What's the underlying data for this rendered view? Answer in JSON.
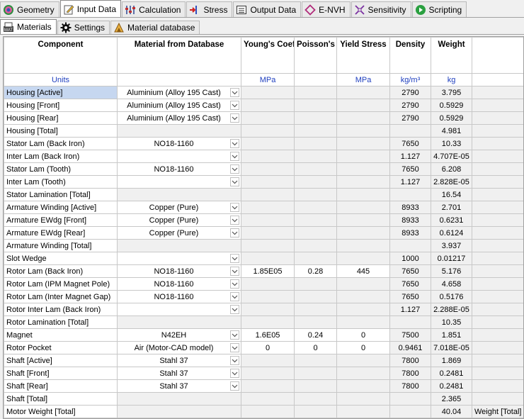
{
  "tabs": [
    {
      "label": "Geometry",
      "icon": "geometry-icon",
      "active": false
    },
    {
      "label": "Input Data",
      "icon": "input-data-icon",
      "active": true
    },
    {
      "label": "Calculation",
      "icon": "calculation-icon",
      "active": false
    },
    {
      "label": "Stress",
      "icon": "stress-icon",
      "active": false
    },
    {
      "label": "Output Data",
      "icon": "output-data-icon",
      "active": false
    },
    {
      "label": "E-NVH",
      "icon": "envh-icon",
      "active": false
    },
    {
      "label": "Sensitivity",
      "icon": "sensitivity-icon",
      "active": false
    },
    {
      "label": "Scripting",
      "icon": "scripting-icon",
      "active": false
    }
  ],
  "subtabs": [
    {
      "label": "Materials",
      "icon": "materials-icon",
      "active": true
    },
    {
      "label": "Settings",
      "icon": "settings-gear-icon",
      "active": false
    },
    {
      "label": "Material database",
      "icon": "material-database-icon",
      "active": false
    }
  ],
  "table": {
    "headers": [
      "Component",
      "Material from Database",
      "Young's Coefficient",
      "Poisson's Ratio",
      "Yield Stress",
      "Density",
      "Weight",
      ""
    ],
    "units": [
      "Units",
      "",
      "MPa",
      "",
      "MPa",
      "kg/m³",
      "kg",
      ""
    ],
    "rows": [
      {
        "name": "Housing [Active]",
        "mat": "Aluminium (Alloy 195 Cast)",
        "dd": true,
        "young": "",
        "poisson": "",
        "yield": "",
        "density": "2790",
        "weight": "3.795",
        "extra": "",
        "sel": true
      },
      {
        "name": "Housing [Front]",
        "mat": "Aluminium (Alloy 195 Cast)",
        "dd": true,
        "young": "",
        "poisson": "",
        "yield": "",
        "density": "2790",
        "weight": "0.5929",
        "extra": ""
      },
      {
        "name": "Housing [Rear]",
        "mat": "Aluminium (Alloy 195 Cast)",
        "dd": true,
        "young": "",
        "poisson": "",
        "yield": "",
        "density": "2790",
        "weight": "0.5929",
        "extra": ""
      },
      {
        "name": "Housing [Total]",
        "mat": "",
        "dd": false,
        "young": "",
        "poisson": "",
        "yield": "",
        "density": "",
        "weight": "4.981",
        "extra": "",
        "total": true
      },
      {
        "name": "Stator Lam (Back Iron)",
        "mat": "NO18-1160",
        "dd": true,
        "young": "",
        "poisson": "",
        "yield": "",
        "density": "7650",
        "weight": "10.33",
        "extra": ""
      },
      {
        "name": "Inter Lam (Back Iron)",
        "mat": "",
        "dd": true,
        "young": "",
        "poisson": "",
        "yield": "",
        "density": "1.127",
        "weight": "4.707E-05",
        "extra": ""
      },
      {
        "name": "Stator Lam (Tooth)",
        "mat": "NO18-1160",
        "dd": true,
        "young": "",
        "poisson": "",
        "yield": "",
        "density": "7650",
        "weight": "6.208",
        "extra": ""
      },
      {
        "name": "Inter Lam (Tooth)",
        "mat": "",
        "dd": true,
        "young": "",
        "poisson": "",
        "yield": "",
        "density": "1.127",
        "weight": "2.828E-05",
        "extra": ""
      },
      {
        "name": "Stator Lamination [Total]",
        "mat": "",
        "dd": false,
        "young": "",
        "poisson": "",
        "yield": "",
        "density": "",
        "weight": "16.54",
        "extra": "",
        "total": true
      },
      {
        "name": "Armature Winding [Active]",
        "mat": "Copper (Pure)",
        "dd": true,
        "young": "",
        "poisson": "",
        "yield": "",
        "density": "8933",
        "weight": "2.701",
        "extra": ""
      },
      {
        "name": "Armature EWdg [Front]",
        "mat": "Copper (Pure)",
        "dd": true,
        "young": "",
        "poisson": "",
        "yield": "",
        "density": "8933",
        "weight": "0.6231",
        "extra": ""
      },
      {
        "name": "Armature EWdg [Rear]",
        "mat": "Copper (Pure)",
        "dd": true,
        "young": "",
        "poisson": "",
        "yield": "",
        "density": "8933",
        "weight": "0.6124",
        "extra": ""
      },
      {
        "name": "Armature Winding [Total]",
        "mat": "",
        "dd": false,
        "young": "",
        "poisson": "",
        "yield": "",
        "density": "",
        "weight": "3.937",
        "extra": "",
        "total": true
      },
      {
        "name": "Slot Wedge",
        "mat": "",
        "dd": true,
        "young": "",
        "poisson": "",
        "yield": "",
        "density": "1000",
        "weight": "0.01217",
        "extra": ""
      },
      {
        "name": "Rotor Lam (Back Iron)",
        "mat": "NO18-1160",
        "dd": true,
        "young": "1.85E05",
        "poisson": "0.28",
        "yield": "445",
        "density": "7650",
        "weight": "5.176",
        "extra": ""
      },
      {
        "name": "Rotor Lam (IPM Magnet Pole)",
        "mat": "NO18-1160",
        "dd": true,
        "young": "",
        "poisson": "",
        "yield": "",
        "density": "7650",
        "weight": "4.658",
        "extra": ""
      },
      {
        "name": "Rotor Lam (Inter Magnet Gap)",
        "mat": "NO18-1160",
        "dd": true,
        "young": "",
        "poisson": "",
        "yield": "",
        "density": "7650",
        "weight": "0.5176",
        "extra": ""
      },
      {
        "name": "Rotor Inter Lam (Back Iron)",
        "mat": "",
        "dd": true,
        "young": "",
        "poisson": "",
        "yield": "",
        "density": "1.127",
        "weight": "2.288E-05",
        "extra": ""
      },
      {
        "name": "Rotor Lamination [Total]",
        "mat": "",
        "dd": false,
        "young": "",
        "poisson": "",
        "yield": "",
        "density": "",
        "weight": "10.35",
        "extra": "",
        "total": true
      },
      {
        "name": "Magnet",
        "mat": "N42EH",
        "dd": true,
        "young": "1.6E05",
        "poisson": "0.24",
        "yield": "0",
        "density": "7500",
        "weight": "1.851",
        "extra": ""
      },
      {
        "name": "Rotor Pocket",
        "mat": "Air (Motor-CAD model)",
        "dd": true,
        "young": "0",
        "poisson": "0",
        "yield": "0",
        "density": "0.9461",
        "weight": "7.018E-05",
        "extra": ""
      },
      {
        "name": "Shaft [Active]",
        "mat": "Stahl 37",
        "dd": true,
        "young": "",
        "poisson": "",
        "yield": "",
        "density": "7800",
        "weight": "1.869",
        "extra": ""
      },
      {
        "name": "Shaft [Front]",
        "mat": "Stahl 37",
        "dd": true,
        "young": "",
        "poisson": "",
        "yield": "",
        "density": "7800",
        "weight": "0.2481",
        "extra": ""
      },
      {
        "name": "Shaft [Rear]",
        "mat": "Stahl 37",
        "dd": true,
        "young": "",
        "poisson": "",
        "yield": "",
        "density": "7800",
        "weight": "0.2481",
        "extra": ""
      },
      {
        "name": "Shaft [Total]",
        "mat": "",
        "dd": false,
        "young": "",
        "poisson": "",
        "yield": "",
        "density": "",
        "weight": "2.365",
        "extra": "",
        "total": true
      },
      {
        "name": "Motor Weight [Total]",
        "mat": "",
        "dd": false,
        "young": "",
        "poisson": "",
        "yield": "",
        "density": "",
        "weight": "40.04",
        "extra": "Weight [Total]",
        "total": true
      }
    ]
  }
}
